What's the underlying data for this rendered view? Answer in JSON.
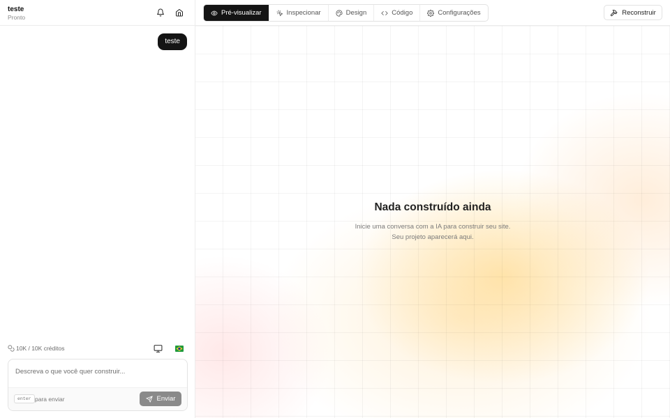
{
  "project": {
    "name": "teste",
    "status": "Pronto"
  },
  "chat": {
    "messages": [
      {
        "role": "user",
        "text": "teste"
      }
    ]
  },
  "credits": {
    "text": "10K / 10K créditos"
  },
  "composer": {
    "placeholder": "Descreva o que você quer construir...",
    "value": "",
    "key_hint": "enter",
    "key_hint_label": "para enviar",
    "send_label": "Enviar"
  },
  "tabs": [
    {
      "label": "Pré-visualizar",
      "icon": "eye-icon",
      "active": true
    },
    {
      "label": "Inspecionar",
      "icon": "pointer-sparkle-icon",
      "active": false
    },
    {
      "label": "Design",
      "icon": "palette-icon",
      "active": false
    },
    {
      "label": "Código",
      "icon": "code-icon",
      "active": false
    },
    {
      "label": "Configurações",
      "icon": "gear-icon",
      "active": false
    }
  ],
  "actions": {
    "rebuild_label": "Reconstruir"
  },
  "preview": {
    "empty_title": "Nada construído ainda",
    "empty_description": "Inicie uma conversa com a IA para construir seu site. Seu projeto aparecerá aqui."
  },
  "colors": {
    "accent_dark": "#141414",
    "send_button": "#8a8a8a",
    "glow_yellow": "#ffd378",
    "glow_pink": "#ffbebe"
  }
}
